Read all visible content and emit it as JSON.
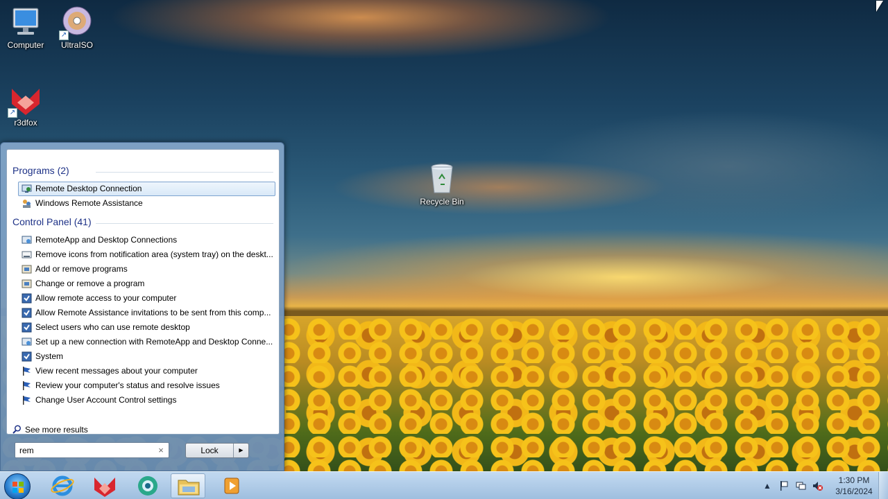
{
  "desktop": {
    "icons": [
      {
        "label": "Computer",
        "icon": "computer-icon"
      },
      {
        "label": "UltraISO",
        "icon": "disc-icon"
      },
      {
        "label": "r3dfox",
        "icon": "r3dfox-icon"
      },
      {
        "label": "Recycle Bin",
        "icon": "recycle-bin-icon"
      }
    ]
  },
  "start_menu": {
    "programs_header": "Programs (2)",
    "programs": [
      {
        "label": "Remote Desktop Connection",
        "icon": "remote-desktop-icon",
        "selected": true
      },
      {
        "label": "Windows Remote Assistance",
        "icon": "remote-assistance-icon",
        "selected": false
      }
    ],
    "control_panel_header": "Control Panel (41)",
    "control_panel": [
      {
        "label": "RemoteApp and Desktop Connections",
        "icon": "remoteapp-icon"
      },
      {
        "label": "Remove icons from notification area (system tray) on the deskt...",
        "icon": "notification-area-icon"
      },
      {
        "label": "Add or remove programs",
        "icon": "programs-features-icon"
      },
      {
        "label": "Change or remove a program",
        "icon": "programs-features-icon"
      },
      {
        "label": "Allow remote access to your computer",
        "icon": "system-icon"
      },
      {
        "label": "Allow Remote Assistance invitations to be sent from this comp...",
        "icon": "system-icon"
      },
      {
        "label": "Select users who can use remote desktop",
        "icon": "system-icon"
      },
      {
        "label": "Set up a new connection with RemoteApp and Desktop Conne...",
        "icon": "remoteapp-icon"
      },
      {
        "label": "System",
        "icon": "system-icon"
      },
      {
        "label": "View recent messages about your computer",
        "icon": "action-center-flag-icon"
      },
      {
        "label": "Review your computer's status and resolve issues",
        "icon": "action-center-flag-icon"
      },
      {
        "label": "Change User Account Control settings",
        "icon": "action-center-flag-icon"
      }
    ],
    "see_more": "See more results",
    "search_value": "rem",
    "clear_glyph": "×",
    "lock_label": "Lock",
    "lock_arrow": "▶"
  },
  "taskbar": {
    "pinned": [
      {
        "name": "internet-explorer-icon",
        "active": false
      },
      {
        "name": "r3dfox-icon",
        "active": false
      },
      {
        "name": "browser-globe-icon",
        "active": false
      },
      {
        "name": "file-explorer-icon",
        "active": true
      },
      {
        "name": "media-player-icon",
        "active": false
      }
    ],
    "tray": {
      "time": "1:30 PM",
      "date": "3/16/2024",
      "icons": [
        "show-hidden-icons-icon",
        "action-center-flag-icon",
        "network-icon",
        "volume-muted-icon"
      ]
    }
  },
  "colors": {
    "section_header": "#1e3287",
    "selection_border": "#7da2ce"
  }
}
